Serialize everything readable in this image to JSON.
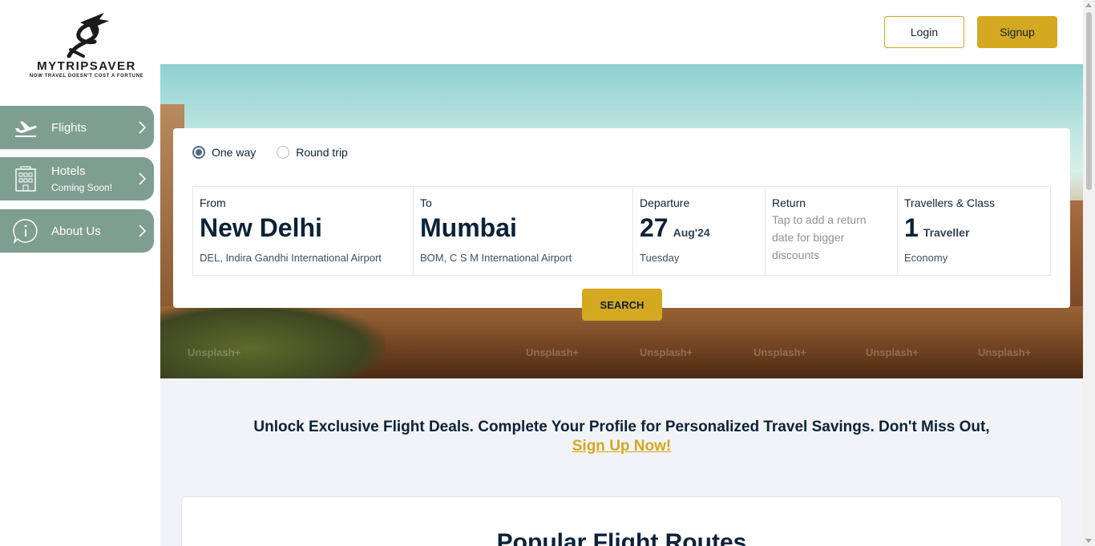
{
  "brand": {
    "name": "MYTRIPSAVER",
    "tagline": "NOW TRAVEL DOESN'T COST A FORTUNE"
  },
  "sidebar": {
    "items": [
      {
        "label": "Flights",
        "sub": "",
        "icon": "airplane-takeoff-icon"
      },
      {
        "label": "Hotels",
        "sub": "Coming Soon!",
        "icon": "hotel-building-icon"
      },
      {
        "label": "About Us",
        "sub": "",
        "icon": "info-circle-icon"
      }
    ]
  },
  "header": {
    "login_label": "Login",
    "signup_label": "Signup"
  },
  "hero": {
    "watermark": "Unsplash+"
  },
  "search": {
    "trip_types": [
      {
        "label": "One way",
        "selected": true
      },
      {
        "label": "Round trip",
        "selected": false
      }
    ],
    "from": {
      "label": "From",
      "city": "New Delhi",
      "detail": "DEL, Indira Gandhi International Airport"
    },
    "to": {
      "label": "To",
      "city": "Mumbai",
      "detail": "BOM, C S M International Airport"
    },
    "departure": {
      "label": "Departure",
      "day": "27",
      "month_year": "Aug'24",
      "weekday": "Tuesday"
    },
    "return": {
      "label": "Return",
      "hint": "Tap to add a return date for bigger discounts"
    },
    "travellers": {
      "label": "Travellers & Class",
      "count": "1",
      "unit": "Traveller",
      "class": "Economy"
    },
    "search_label": "SEARCH"
  },
  "promo": {
    "text": "Unlock Exclusive Flight Deals. Complete Your Profile for Personalized Travel Savings. Don't Miss Out,",
    "link": "Sign Up Now!"
  },
  "routes": {
    "title": "Popular Flight Routes"
  },
  "colors": {
    "accent": "#d4a820",
    "sidebar": "#7f9e92",
    "text": "#0b2238"
  }
}
